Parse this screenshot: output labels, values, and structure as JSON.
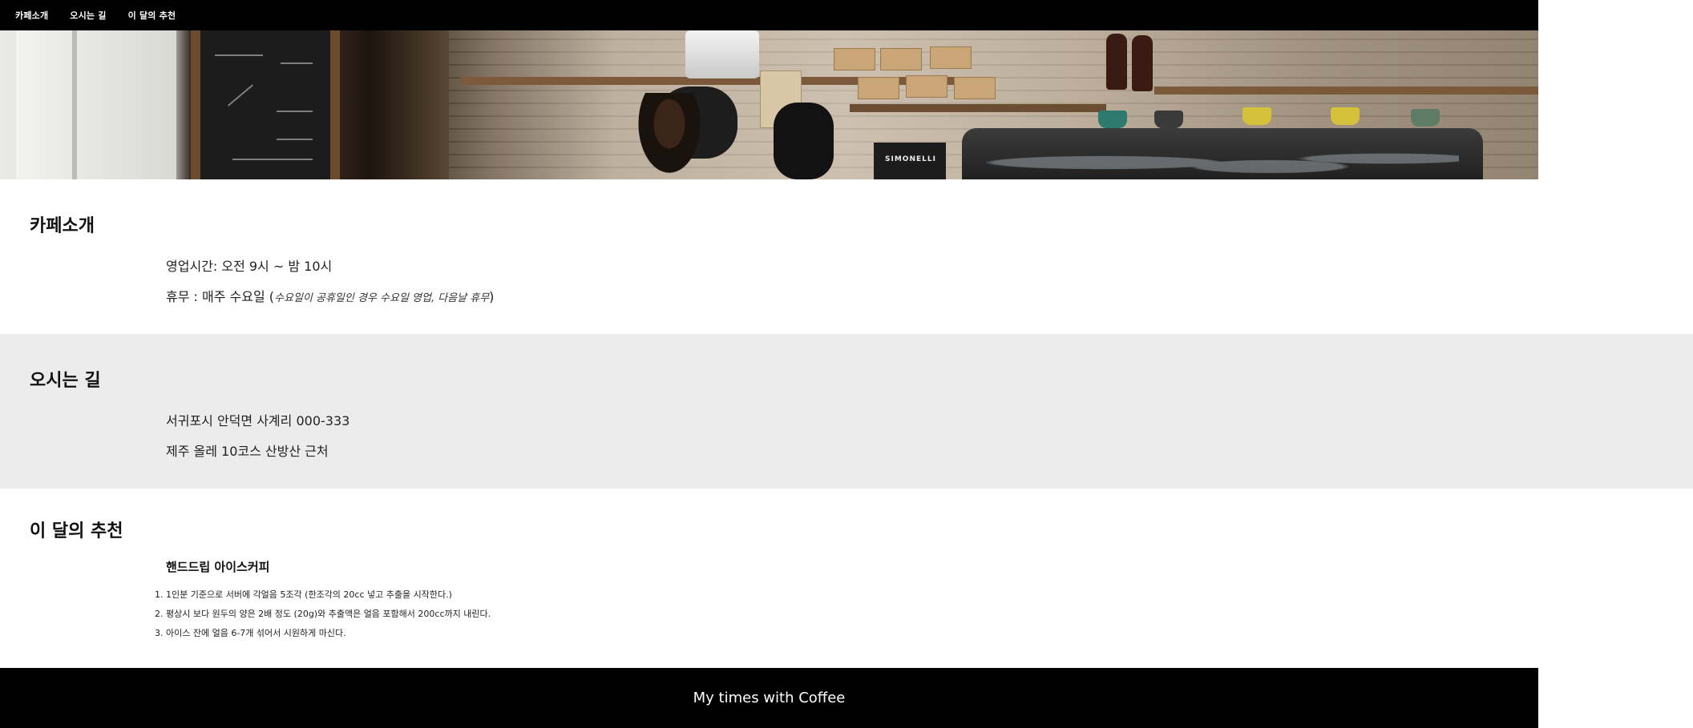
{
  "nav": {
    "items": [
      {
        "label": "카페소개"
      },
      {
        "label": "오시는 길"
      },
      {
        "label": "이 달의 추천"
      }
    ]
  },
  "hero": {
    "machine_brand": "SIMONELLI"
  },
  "about": {
    "title": "카페소개",
    "hours": "영업시간: 오전 9시 ~ 밤 10시",
    "closed_prefix": "휴무 : 매주 수요일 (",
    "closed_note": "수요일이 공휴일인 경우 수요일 영업, 다음날 휴무",
    "closed_suffix": ")"
  },
  "directions": {
    "title": "오시는 길",
    "address": "서귀포시 안덕면 사계리 000-333",
    "landmark": "제주 올레 10코스 산방산 근처"
  },
  "recommend": {
    "title": "이 달의 추천",
    "menu_name": "핸드드립 아이스커피",
    "steps": [
      "1인분 기준으로 서버에 각얼음 5조각 (한조각의 20cc 넣고 추출을 시작한다.)",
      "평상시 보다 원두의 양은 2배 정도 (20g)와 추출액은 얼음 포함해서 200cc까지 내린다.",
      "아이스 잔에 얼음 6-7개 섞어서 시원하게 마신다."
    ]
  },
  "footer": {
    "text": "My times with Coffee"
  }
}
